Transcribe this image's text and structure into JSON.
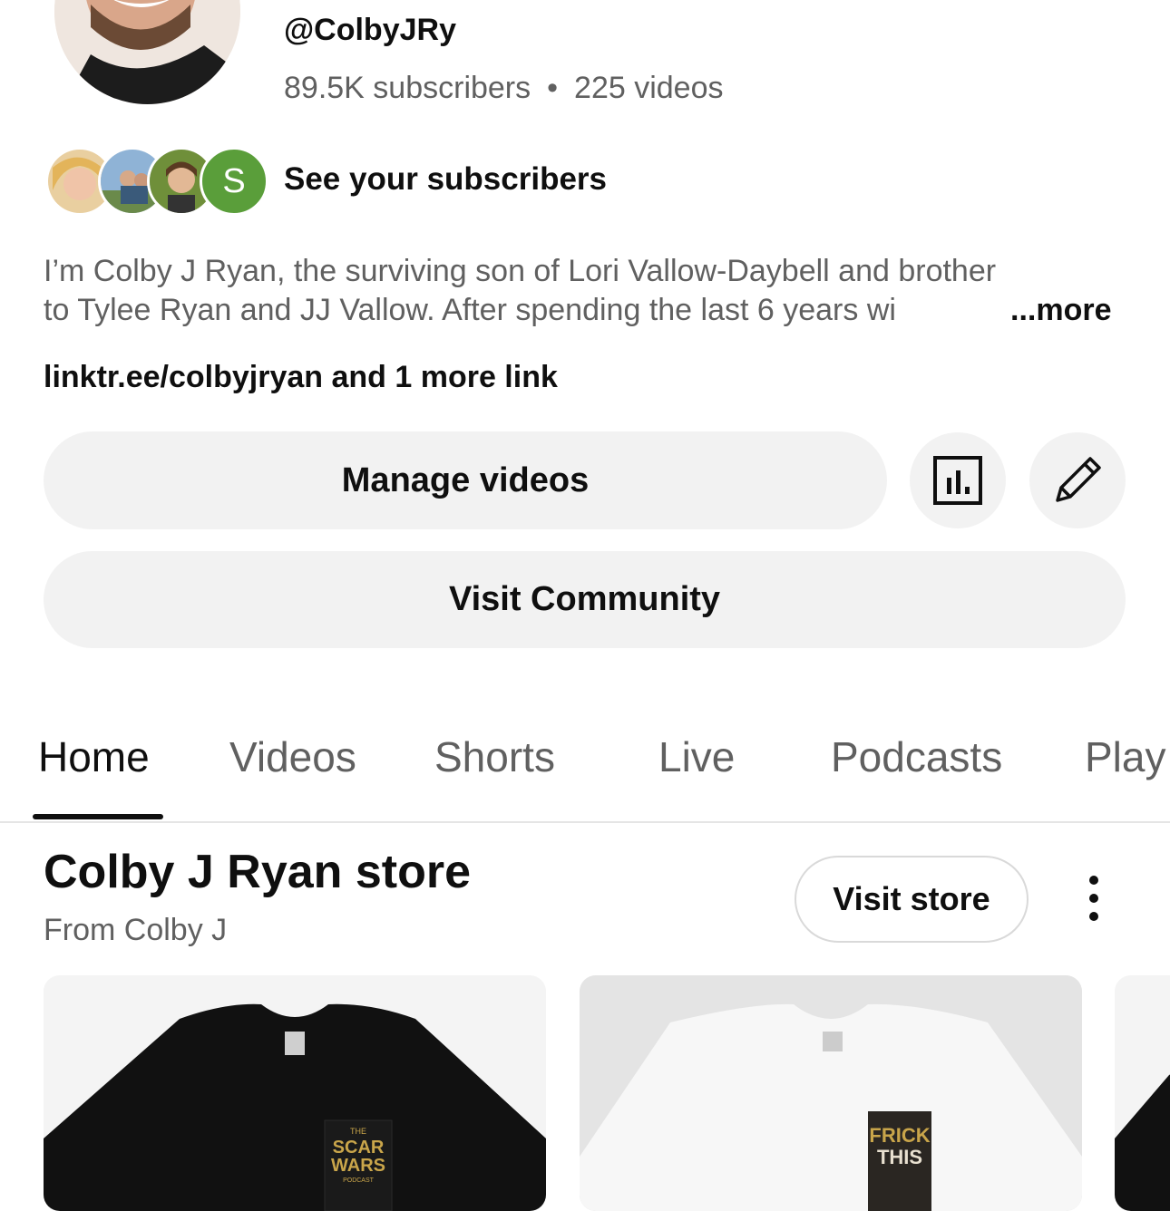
{
  "channel": {
    "handle": "@ColbyJRy",
    "subscribers": "89.5K subscribers",
    "separator": "•",
    "videos": "225 videos",
    "subscriber_initial": "S",
    "see_subscribers": "See your subscribers",
    "description_line1": "I’m Colby J Ryan, the surviving son of Lori Vallow-Daybell and brother",
    "description_line2": "to Tylee Ryan and JJ Vallow. After spending the last 6 years wi",
    "more_label": "...more",
    "links": "linktr.ee/colbyjryan and 1 more link"
  },
  "actions": {
    "manage_videos": "Manage videos",
    "analytics_icon": "analytics-icon",
    "edit_icon": "pencil-icon",
    "visit_community": "Visit Community"
  },
  "tabs": [
    {
      "label": "Home",
      "active": true
    },
    {
      "label": "Videos"
    },
    {
      "label": "Shorts"
    },
    {
      "label": "Live"
    },
    {
      "label": "Podcasts"
    },
    {
      "label": "Play"
    }
  ],
  "store": {
    "title": "Colby J Ryan store",
    "subtitle": "From Colby J",
    "visit_store": "Visit store",
    "products": [
      {
        "print_line1": "THE",
        "print_line2": "SCAR",
        "print_line3": "WARS",
        "print_line4": "PODCAST"
      },
      {
        "print_line1": "FRICK",
        "print_line2": "THIS"
      }
    ]
  },
  "colors": {
    "primary_text": "#0f0f0f",
    "secondary_text": "#606060",
    "pill_bg": "#f2f2f2",
    "subscriber_green": "#5a9e3a"
  }
}
